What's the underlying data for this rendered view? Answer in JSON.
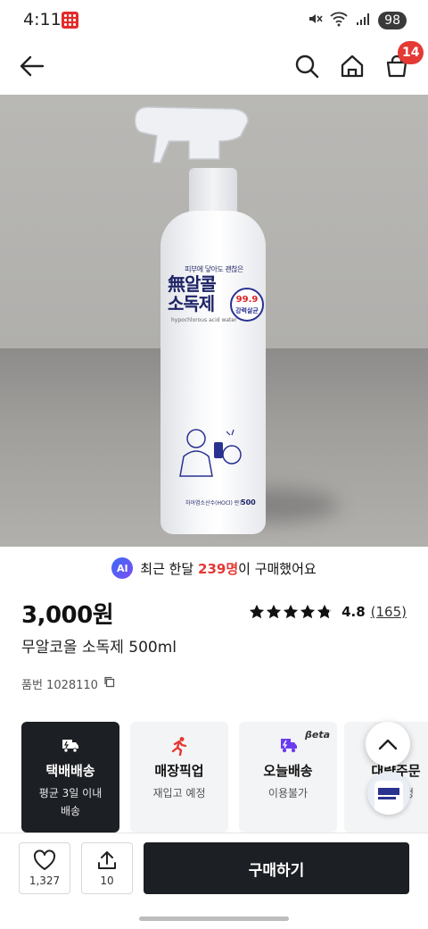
{
  "status_bar": {
    "time": "4:11",
    "battery": "98"
  },
  "nav": {
    "cart_count": "14"
  },
  "hero": {
    "bottle_label_small": "피부에 닿아도 괜찮은",
    "bottle_label_title_1": "無알콜",
    "bottle_label_title_2": "소독제",
    "bottle_label_badge": "99.9",
    "bottle_label_badge_sub": "강력살균",
    "bottle_label_sub": "hypochlorous acid water",
    "bottle_volume": "500",
    "bottle_foot": "차아염소산수(HOCl) 란?",
    "slide_count": "1"
  },
  "ai_notice": {
    "prefix": "최근 한달 ",
    "highlight": "239명",
    "suffix": "이 구매했어요",
    "badge": "AI"
  },
  "product": {
    "price": "3,000원",
    "rating_value": "4.8",
    "rating_count": "(165)",
    "rating": 4.8,
    "name": "무알코올 소독제 500ml",
    "sku": "품번 1028110"
  },
  "delivery_options": [
    {
      "title": "택배배송",
      "desc_1": "평균 3일 이내",
      "desc_2": "배송",
      "icon": "truck-icon"
    },
    {
      "title": "매장픽업",
      "desc_1": "재입고 예정",
      "desc_2": "",
      "icon": "running-person-icon"
    },
    {
      "title": "오늘배송",
      "desc_1": "이용불가",
      "desc_2": "",
      "icon": "fast-delivery-icon",
      "badge": "βeta"
    },
    {
      "title": "대량주문",
      "desc_1": "오픈예정",
      "desc_2": "",
      "icon": "bulk-order-icon"
    }
  ],
  "bottom_bar": {
    "like_count": "1,327",
    "share_count": "10",
    "buy_label": "구매하기"
  },
  "colors": {
    "accent_red": "#e43935",
    "dark": "#1c1f24"
  }
}
